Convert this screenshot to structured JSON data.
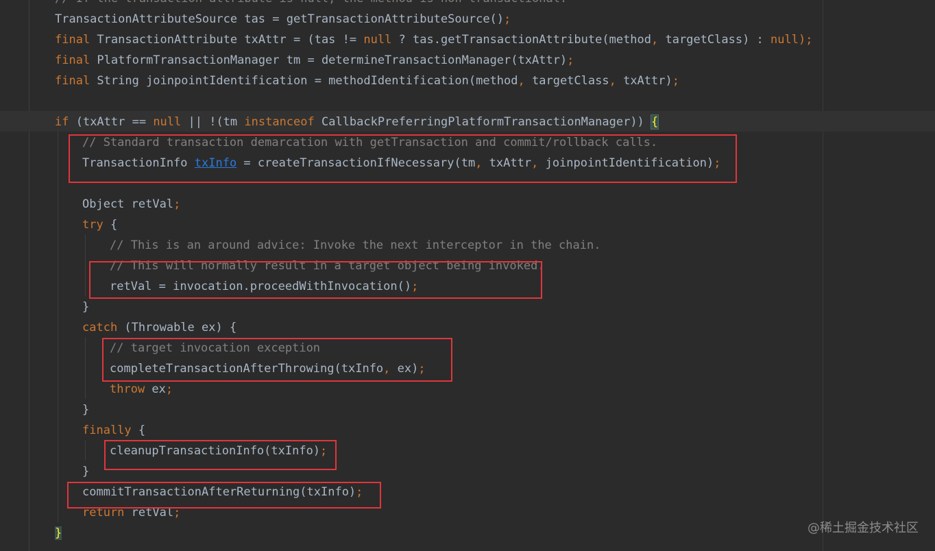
{
  "editor": {
    "lines": [
      {
        "tokens": [
          {
            "t": "// If the transaction attribute is null, the method is non-transactional.",
            "c": "cm"
          }
        ]
      },
      {
        "tokens": [
          {
            "t": "TransactionAttributeSource tas = getTransactionAttributeSource()",
            "c": "id"
          },
          {
            "t": ";",
            "c": "kw"
          }
        ]
      },
      {
        "tokens": [
          {
            "t": "final ",
            "c": "kw"
          },
          {
            "t": "TransactionAttribute txAttr = (tas != ",
            "c": "id"
          },
          {
            "t": "null",
            "c": "kw"
          },
          {
            "t": " ? tas.getTransactionAttribute(method",
            "c": "id"
          },
          {
            "t": ", ",
            "c": "kw"
          },
          {
            "t": "targetClass) : ",
            "c": "id"
          },
          {
            "t": "null",
            "c": "kw"
          },
          {
            "t": ");",
            "c": "kw"
          }
        ]
      },
      {
        "tokens": [
          {
            "t": "final ",
            "c": "kw"
          },
          {
            "t": "PlatformTransactionManager tm = determineTransactionManager(txAttr)",
            "c": "id"
          },
          {
            "t": ";",
            "c": "kw"
          }
        ]
      },
      {
        "tokens": [
          {
            "t": "final ",
            "c": "kw"
          },
          {
            "t": "String joinpointIdentification = methodIdentification(method",
            "c": "id"
          },
          {
            "t": ", ",
            "c": "kw"
          },
          {
            "t": "targetClass",
            "c": "id"
          },
          {
            "t": ", ",
            "c": "kw"
          },
          {
            "t": "txAttr)",
            "c": "id"
          },
          {
            "t": ";",
            "c": "kw"
          }
        ]
      },
      {
        "tokens": []
      },
      {
        "tokens": [
          {
            "t": "if ",
            "c": "kw"
          },
          {
            "t": "(txAttr == ",
            "c": "id"
          },
          {
            "t": "null",
            "c": "kw"
          },
          {
            "t": " || !(tm ",
            "c": "id"
          },
          {
            "t": "instanceof ",
            "c": "kw"
          },
          {
            "t": "CallbackPreferringPlatformTransactionManager)) ",
            "c": "id"
          },
          {
            "t": "{",
            "c": "brace-match"
          }
        ]
      },
      {
        "tokens": [
          {
            "t": "// Standard transaction demarcation with getTransaction and commit/rollback calls.",
            "c": "cm"
          }
        ]
      },
      {
        "tokens": [
          {
            "t": "TransactionInfo ",
            "c": "id"
          },
          {
            "t": "txInfo",
            "c": "link"
          },
          {
            "t": " = createTransactionIfNecessary(tm",
            "c": "id"
          },
          {
            "t": ", ",
            "c": "kw"
          },
          {
            "t": "txAttr",
            "c": "id"
          },
          {
            "t": ", ",
            "c": "kw"
          },
          {
            "t": "joinpointIdentification)",
            "c": "id"
          },
          {
            "t": ";",
            "c": "kw"
          }
        ]
      },
      {
        "tokens": []
      },
      {
        "tokens": [
          {
            "t": "Object retVal",
            "c": "id"
          },
          {
            "t": ";",
            "c": "kw"
          }
        ]
      },
      {
        "tokens": [
          {
            "t": "try ",
            "c": "kw"
          },
          {
            "t": "{",
            "c": "id"
          }
        ]
      },
      {
        "tokens": [
          {
            "t": "// This is an around advice: Invoke the next interceptor in the chain.",
            "c": "cm"
          }
        ]
      },
      {
        "tokens": [
          {
            "t": "// This will normally result in a target object being invoked.",
            "c": "cm"
          }
        ]
      },
      {
        "tokens": [
          {
            "t": "retVal = invocation.proceedWithInvocation()",
            "c": "id"
          },
          {
            "t": ";",
            "c": "kw"
          }
        ]
      },
      {
        "tokens": [
          {
            "t": "}",
            "c": "id"
          }
        ]
      },
      {
        "tokens": [
          {
            "t": "catch ",
            "c": "kw"
          },
          {
            "t": "(Throwable ex) {",
            "c": "id"
          }
        ]
      },
      {
        "tokens": [
          {
            "t": "// target invocation exception",
            "c": "cm"
          }
        ]
      },
      {
        "tokens": [
          {
            "t": "completeTransactionAfterThrowing(txInfo",
            "c": "id"
          },
          {
            "t": ", ",
            "c": "kw"
          },
          {
            "t": "ex)",
            "c": "id"
          },
          {
            "t": ";",
            "c": "kw"
          }
        ]
      },
      {
        "tokens": [
          {
            "t": "throw ",
            "c": "kw"
          },
          {
            "t": "ex",
            "c": "id"
          },
          {
            "t": ";",
            "c": "kw"
          }
        ]
      },
      {
        "tokens": [
          {
            "t": "}",
            "c": "id"
          }
        ]
      },
      {
        "tokens": [
          {
            "t": "finally ",
            "c": "kw"
          },
          {
            "t": "{",
            "c": "id"
          }
        ]
      },
      {
        "tokens": [
          {
            "t": "cleanupTransactionInfo(txInfo)",
            "c": "id"
          },
          {
            "t": ";",
            "c": "kw"
          }
        ]
      },
      {
        "tokens": [
          {
            "t": "}",
            "c": "id"
          }
        ]
      },
      {
        "tokens": [
          {
            "t": "commitTransactionAfterReturning(txInfo)",
            "c": "id"
          },
          {
            "t": ";",
            "c": "kw"
          }
        ]
      },
      {
        "tokens": [
          {
            "t": "return ",
            "c": "kw"
          },
          {
            "t": "retVal",
            "c": "id"
          },
          {
            "t": ";",
            "c": "kw"
          }
        ]
      },
      {
        "tokens": [
          {
            "t": "}",
            "c": "brace-end"
          }
        ]
      }
    ]
  },
  "watermark": "@稀土掘金技术社区",
  "colors": {
    "background": "#2b2b2b",
    "keyword": "#cc7832",
    "comment": "#808080",
    "identifier": "#a9b7c6",
    "link": "#287bde",
    "highlight_box": "#e0363c"
  }
}
